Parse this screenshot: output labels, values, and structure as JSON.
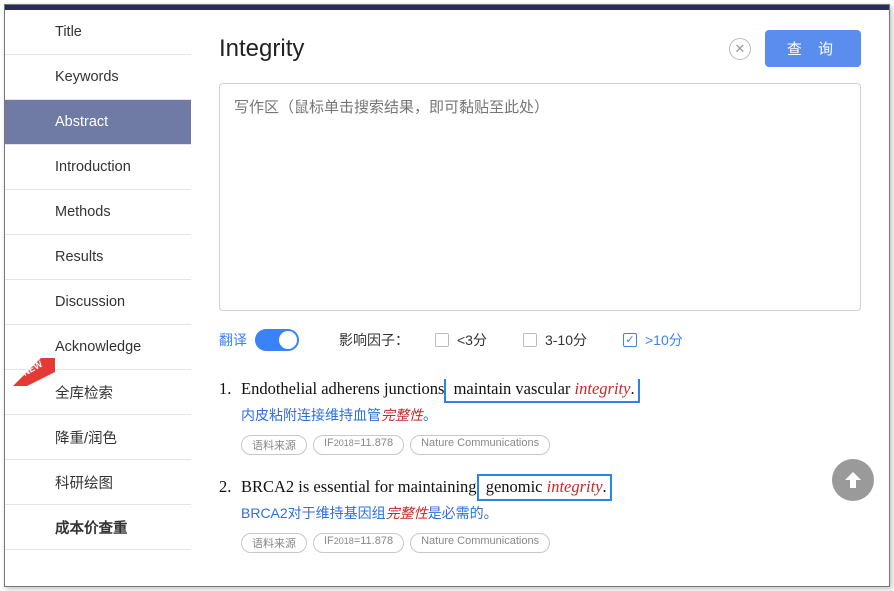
{
  "sidebar": [
    "Title",
    "Keywords",
    "Abstract",
    "Introduction",
    "Methods",
    "Results",
    "Discussion",
    "Acknowledge",
    "全库检索",
    "降重/润色",
    "科研绘图",
    "成本价查重"
  ],
  "search": {
    "value": "Integrity",
    "button": "查 询"
  },
  "writing": {
    "placeholder": "写作区（鼠标单击搜索结果，即可黏贴至此处）"
  },
  "filters": {
    "translate": "翻译",
    "if_label": "影响因子：",
    "opts": [
      "<3分",
      "3-10分",
      ">10分"
    ]
  },
  "results": [
    {
      "num": "1.",
      "pre": "Endothelial adherens junctions",
      "box_pre": " maintain vascular",
      "kw": "integrity",
      "box_post": ".",
      "trans_pre": "内皮粘附连接维持血管",
      "trans_kw": "完整性",
      "trans_post": "。",
      "tags": [
        "语料来源",
        "Nature Communications"
      ],
      "if": "11.878"
    },
    {
      "num": "2.",
      "pre": "BRCA2 is essential for maintaining",
      "box_pre": " genomic",
      "kw": "integrity",
      "box_post": ".",
      "trans_pre": "BRCA2对于维持基因组",
      "trans_kw": "完整性",
      "trans_post": "是必需的。",
      "tags": [
        "语料来源",
        "Nature Communications"
      ],
      "if": "11.878"
    }
  ]
}
